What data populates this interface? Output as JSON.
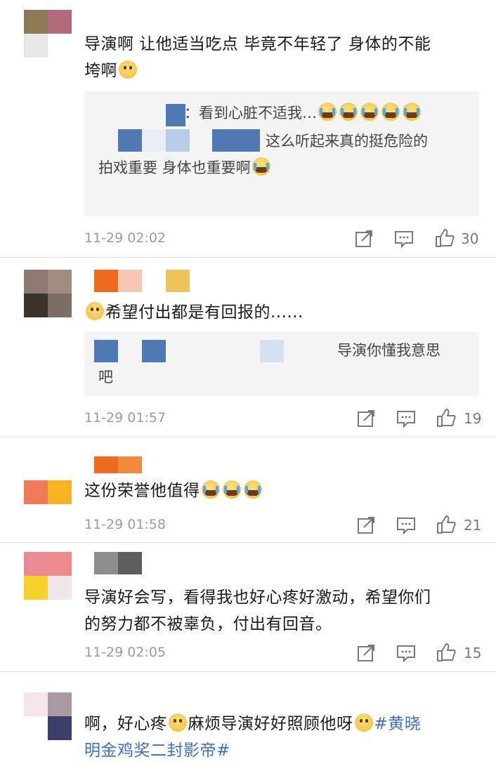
{
  "comments": [
    {
      "text_line1": "导演啊 让他适当吃点 毕竟不年轻了 身体的不能",
      "text_line2": "垮啊",
      "reply_line1": "：看到心脏不适我…",
      "reply_line2": "这么听起来真的挺危险的",
      "reply_line3": "拍戏重要 身体也重要啊",
      "time": "11-29 02:02",
      "likes": "30"
    },
    {
      "text": "希望付出都是有回报的......",
      "reply_line1": "导演你懂我意思",
      "reply_line2": "吧",
      "time": "11-29 01:57",
      "likes": "19"
    },
    {
      "text": "这份荣誉他值得",
      "time": "11-29 01:58",
      "likes": "21"
    },
    {
      "text_line1": "导演好会写，看得我也好心疼好激动，希望你们",
      "text_line2": "的努力都不被辜负，付出有回音。",
      "time": "11-29 02:05",
      "likes": "15"
    },
    {
      "text_line1_a": "啊，好心疼",
      "text_line1_b": "麻烦导演好好照顾他呀",
      "hashtag_a": "#黄晓",
      "hashtag_b": "明金鸡奖二封影帝#"
    }
  ],
  "icons": {
    "share": "share-icon",
    "comment": "comment-icon",
    "like": "thumbs-up-icon",
    "emoji_sad": "pleading-face-icon",
    "emoji_cry": "crying-face-icon"
  },
  "colors": {
    "hashtag": "#3f70c0",
    "meta": "#9b9b9b"
  }
}
